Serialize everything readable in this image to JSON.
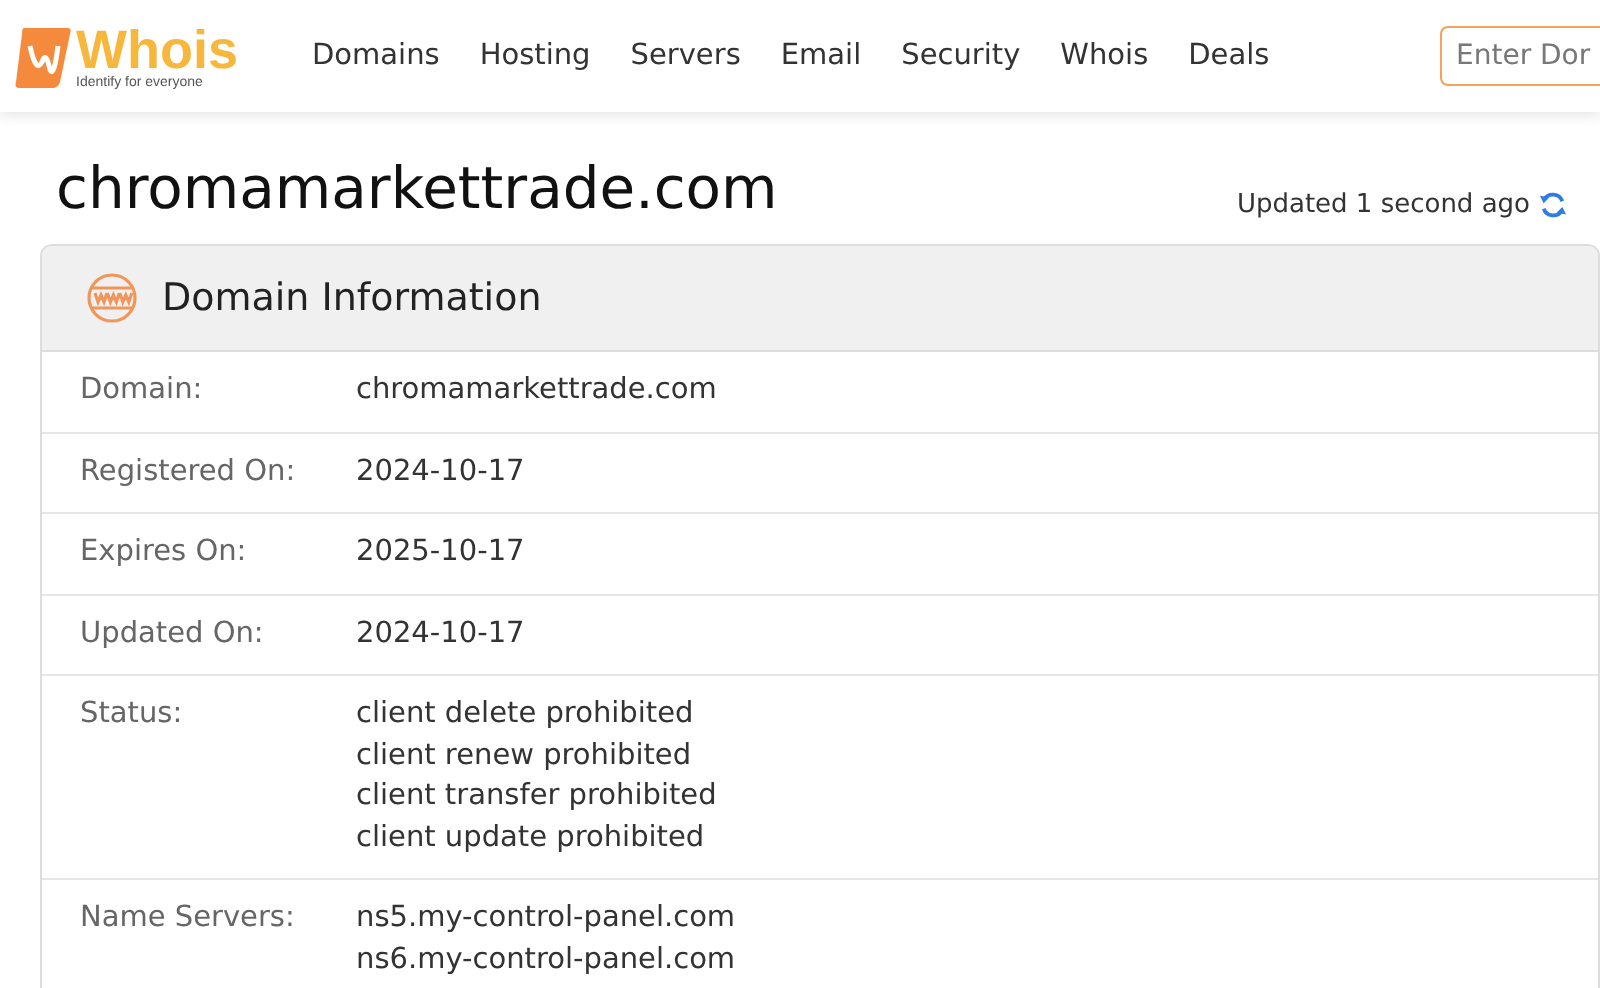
{
  "logo": {
    "name": "Whois",
    "tagline": "Identify for everyone"
  },
  "nav": [
    "Domains",
    "Hosting",
    "Servers",
    "Email",
    "Security",
    "Whois",
    "Deals"
  ],
  "search": {
    "placeholder": "Enter Dor"
  },
  "page_title": "chromamarkettrade.com",
  "updated": "Updated 1 second ago",
  "card": {
    "title": "Domain Information",
    "rows": [
      {
        "label": "Domain:",
        "values": [
          "chromamarkettrade.com"
        ]
      },
      {
        "label": "Registered On:",
        "values": [
          "2024-10-17"
        ]
      },
      {
        "label": "Expires On:",
        "values": [
          "2025-10-17"
        ]
      },
      {
        "label": "Updated On:",
        "values": [
          "2024-10-17"
        ]
      },
      {
        "label": "Status:",
        "values": [
          "client delete prohibited",
          "client renew prohibited",
          "client transfer prohibited",
          "client update prohibited"
        ]
      },
      {
        "label": "Name Servers:",
        "values": [
          "ns5.my-control-panel.com",
          "ns6.my-control-panel.com"
        ]
      }
    ]
  }
}
